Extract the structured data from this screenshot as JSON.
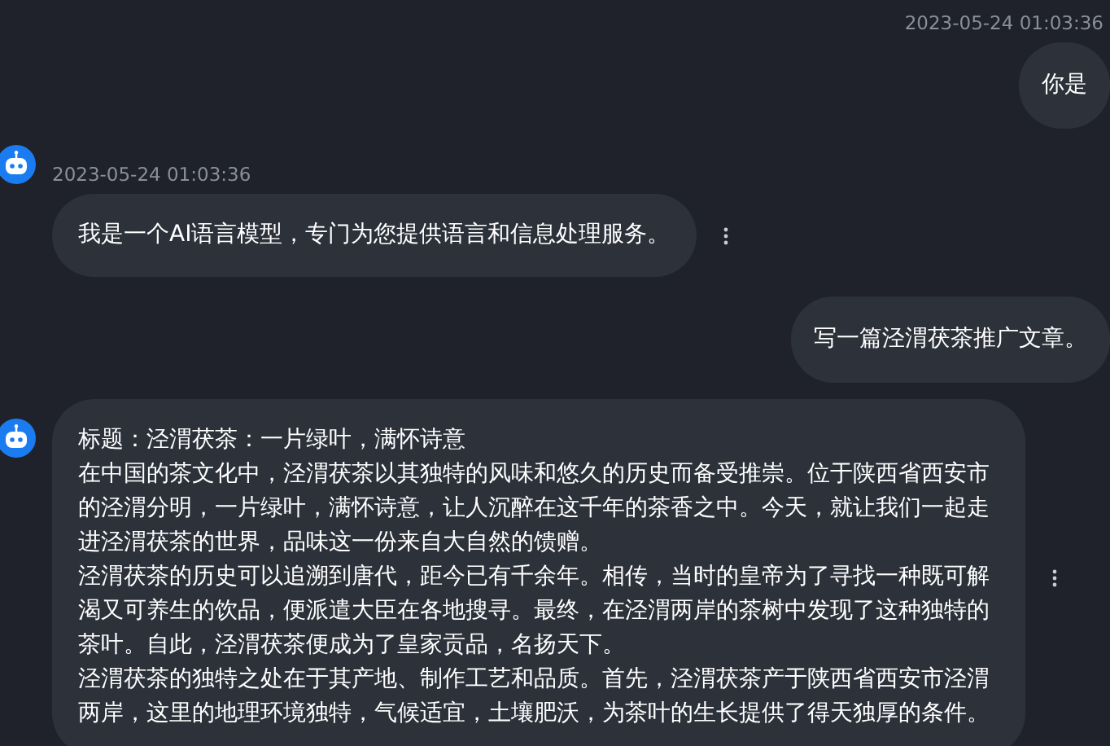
{
  "messages": [
    {
      "kind": "user",
      "timestamp": "2023-05-24 01:03:36",
      "paragraphs": [
        "你是"
      ]
    },
    {
      "kind": "bot",
      "timestamp": "2023-05-24 01:03:36",
      "paragraphs": [
        "我是一个AI语言模型，专门为您提供语言和信息处理服务。"
      ]
    },
    {
      "kind": "user",
      "paragraphs": [
        "写一篇泾渭茯茶推广文章。"
      ]
    },
    {
      "kind": "bot",
      "paragraphs": [
        "标题：泾渭茯茶：一片绿叶，满怀诗意",
        "在中国的茶文化中，泾渭茯茶以其独特的风味和悠久的历史而备受推崇。位于陕西省西安市的泾渭分明，一片绿叶，满怀诗意，让人沉醉在这千年的茶香之中。今天，就让我们一起走进泾渭茯茶的世界，品味这一份来自大自然的馈赠。",
        "泾渭茯茶的历史可以追溯到唐代，距今已有千余年。相传，当时的皇帝为了寻找一种既可解渴又可养生的饮品，便派遣大臣在各地搜寻。最终，在泾渭两岸的茶树中发现了这种独特的茶叶。自此，泾渭茯茶便成为了皇家贡品，名扬天下。",
        "泾渭茯茶的独特之处在于其产地、制作工艺和品质。首先，泾渭茯茶产于陕西省西安市泾渭两岸，这里的地理环境独特，气候适宜，土壤肥沃，为茶叶的生长提供了得天独厚的条件。"
      ]
    }
  ]
}
